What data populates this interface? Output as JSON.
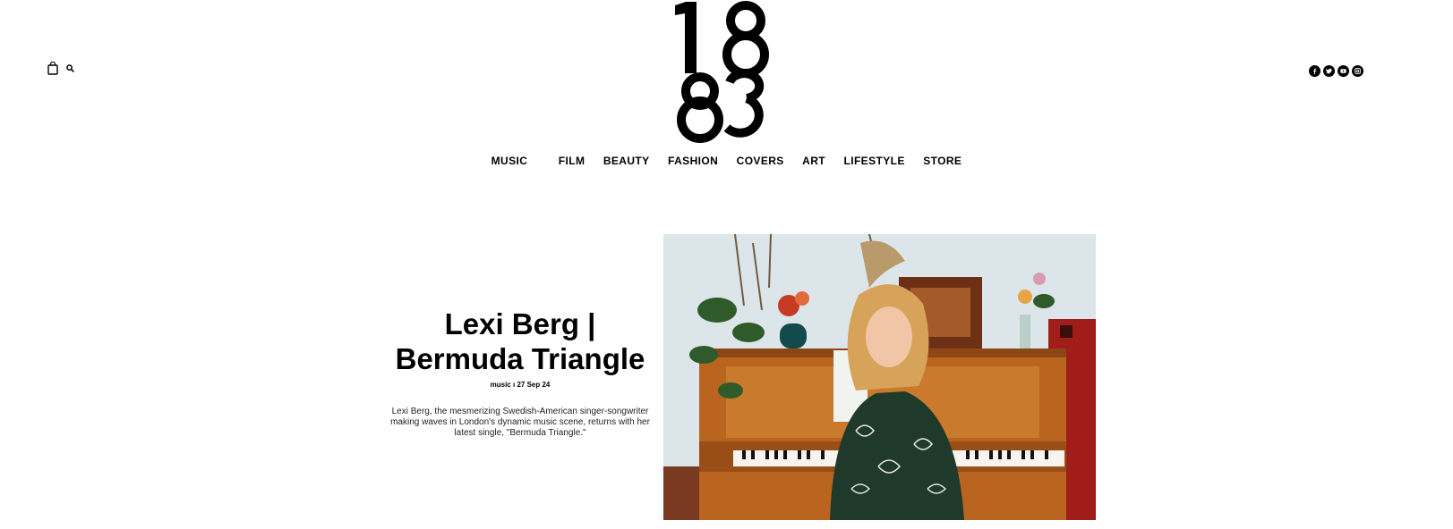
{
  "header": {
    "logo_text": "1883",
    "cart_icon": "shopping-bag-icon",
    "search_icon": "search-icon",
    "social_icons": [
      "facebook-icon",
      "twitter-icon",
      "youtube-icon",
      "instagram-icon"
    ]
  },
  "nav": {
    "items": [
      {
        "label": "MUSIC"
      },
      {
        "label": "FILM"
      },
      {
        "label": "BEAUTY"
      },
      {
        "label": "FASHION"
      },
      {
        "label": "COVERS"
      },
      {
        "label": "ART"
      },
      {
        "label": "LIFESTYLE"
      },
      {
        "label": "STORE"
      }
    ]
  },
  "article": {
    "title_line1": "Lexi Berg |",
    "title_line2": "Bermuda Triangle",
    "category": "music",
    "separator": "ı",
    "date": "27  Sep 24",
    "excerpt_line1": "Lexi Berg, the mesmerizing Swedish-American singer-songwriter",
    "excerpt_line2": "making waves in London's dynamic music scene, returns with her",
    "excerpt_line3": "latest single, \"Bermuda Triangle.\""
  }
}
